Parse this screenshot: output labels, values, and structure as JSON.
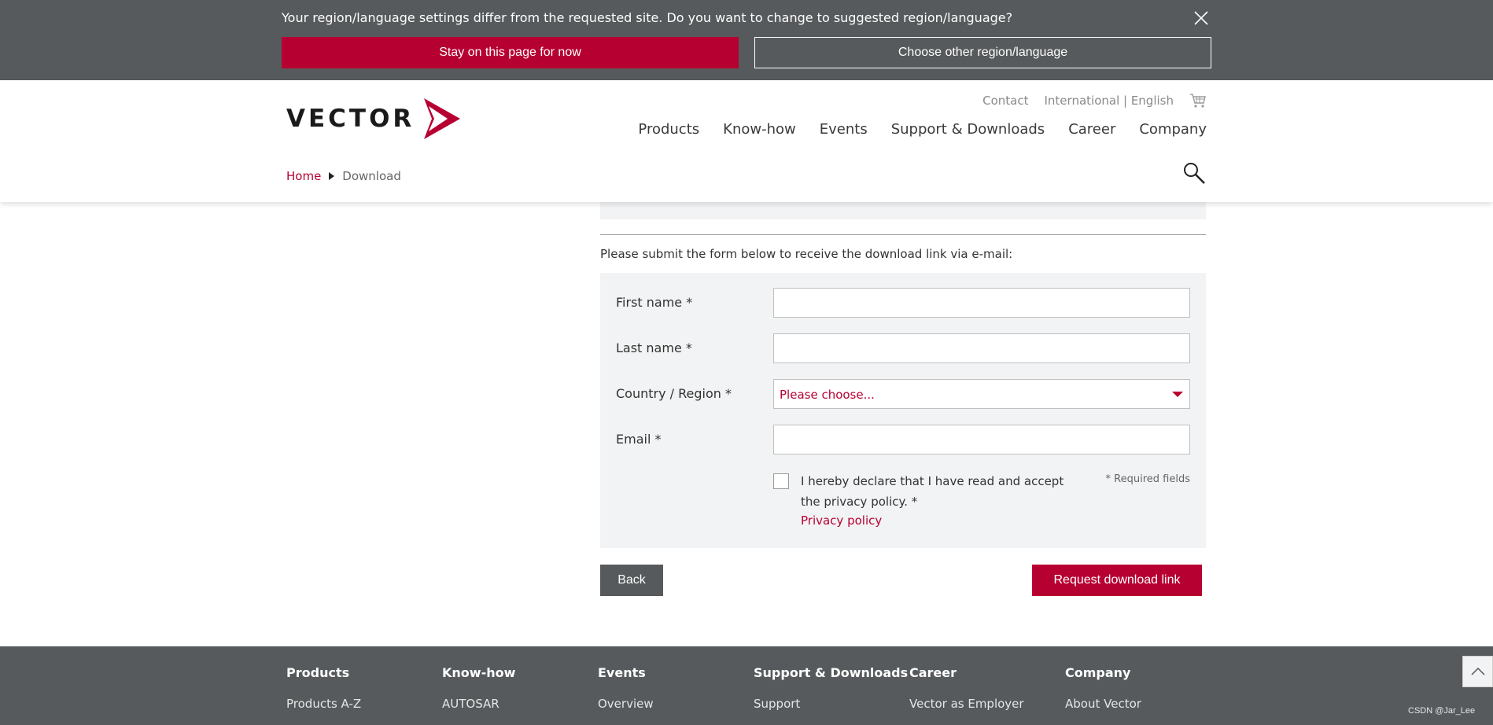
{
  "region_banner": {
    "message": "Your region/language settings differ from the requested site. Do you want to change to suggested region/language?",
    "stay_label": "Stay on this page for now",
    "choose_label": "Choose other region/language"
  },
  "header": {
    "logo_text": "VECTOR",
    "top_links": {
      "contact": "Contact",
      "region": "International | English"
    },
    "nav": [
      "Products",
      "Know-how",
      "Events",
      "Support & Downloads",
      "Career",
      "Company"
    ]
  },
  "breadcrumb": {
    "home": "Home",
    "current": "Download"
  },
  "form": {
    "intro": "Please submit the form below to receive the download link via e-mail:",
    "first_name_label": "First name *",
    "last_name_label": "Last name *",
    "country_label": "Country / Region *",
    "country_value": "Please choose...",
    "email_label": "Email *",
    "consent_text": "I hereby declare that I have read and accept the privacy policy. *",
    "privacy_link": "Privacy policy",
    "required_note": "* Required fields",
    "back_label": "Back",
    "request_label": "Request download link"
  },
  "footer": {
    "columns": [
      {
        "heading": "Products",
        "link": "Products A-Z"
      },
      {
        "heading": "Know-how",
        "link": "AUTOSAR"
      },
      {
        "heading": "Events",
        "link": "Overview"
      },
      {
        "heading": "Support & Downloads",
        "link": "Support"
      },
      {
        "heading": "Career",
        "link": "Vector as Employer"
      },
      {
        "heading": "Company",
        "link": "About Vector"
      }
    ]
  },
  "watermark": "CSDN @Jar_Lee",
  "colors": {
    "brand": "#b70032",
    "banner": "#565a5c",
    "form_bg": "#f2f3f4"
  },
  "icons": [
    "close-icon",
    "vector-arrow-logo",
    "cart-icon",
    "search-icon",
    "chevron-down-icon",
    "chevron-up-icon"
  ]
}
